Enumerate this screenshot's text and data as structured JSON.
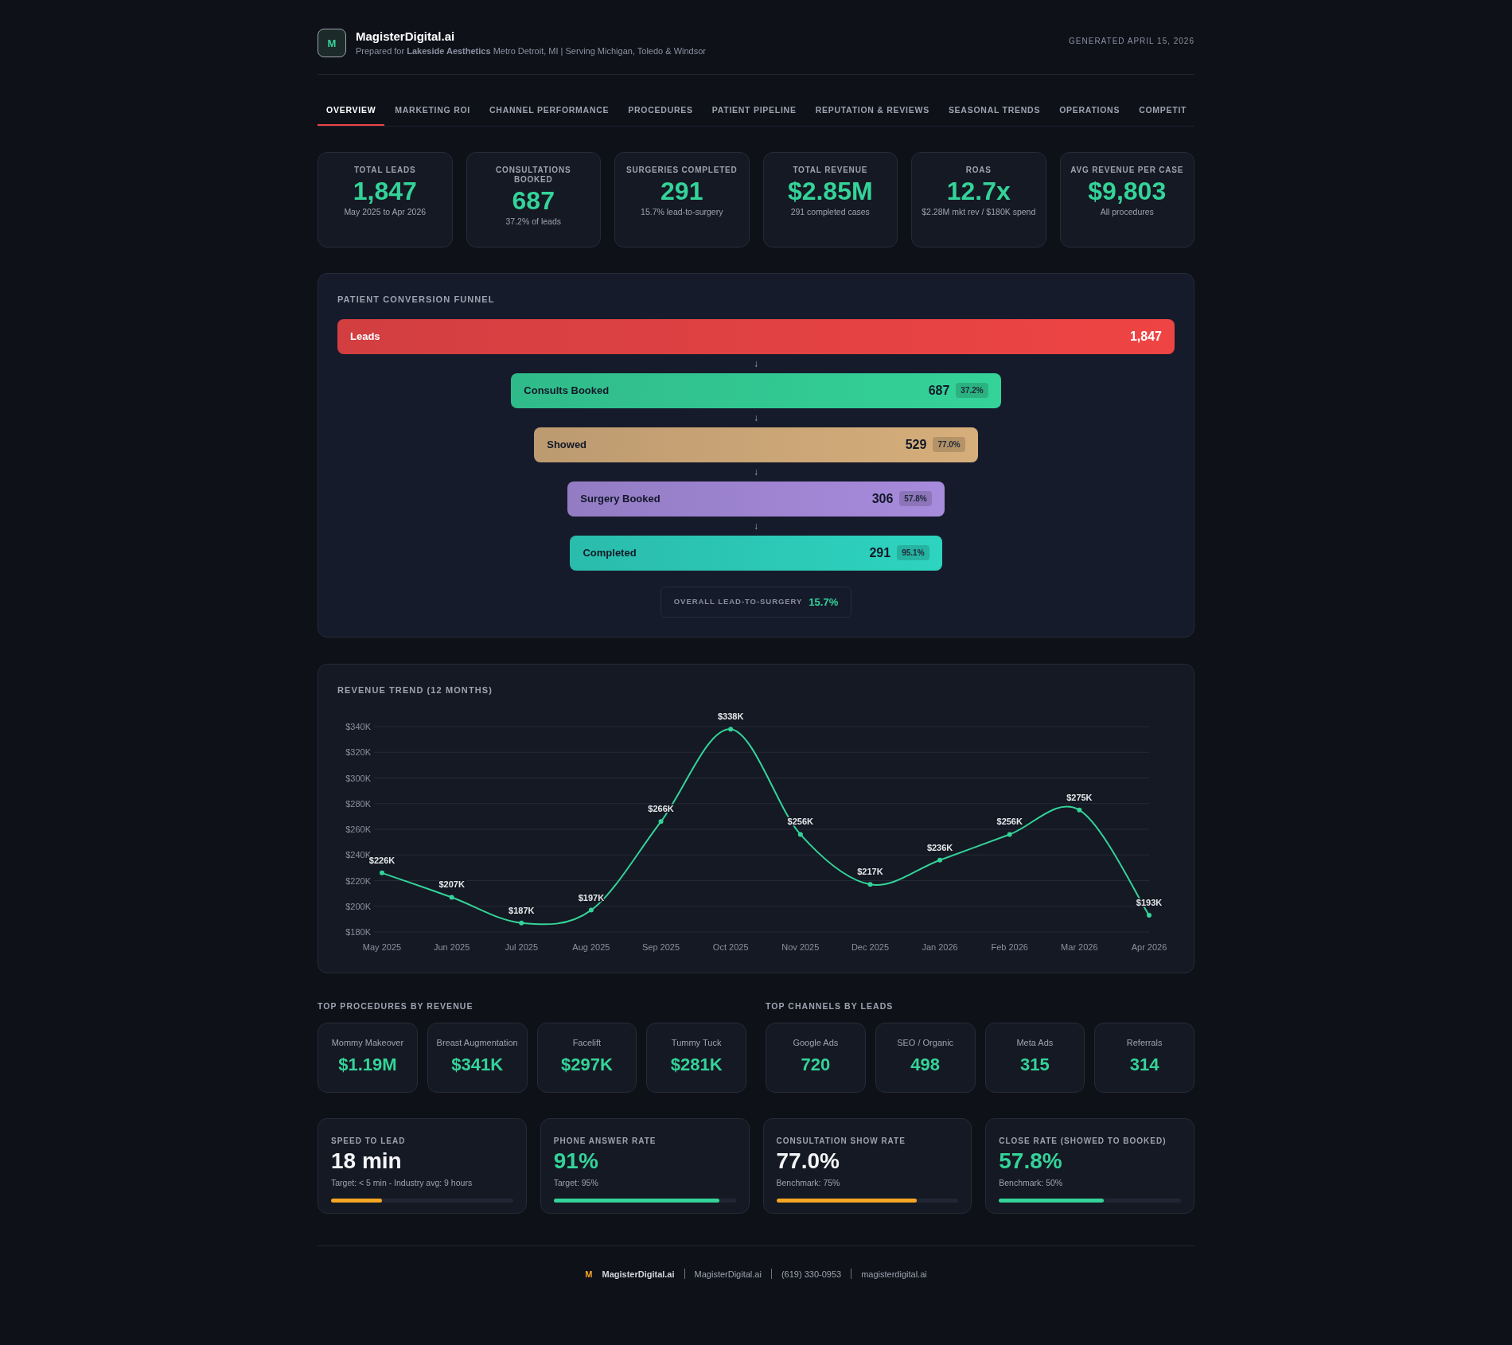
{
  "header": {
    "logo_letter": "M",
    "brand": "MagisterDigital.ai",
    "subtitle": "Prepared for **Lakeside Aesthetics** Metro Detroit, MI | Serving Michigan, Toledo & Windsor",
    "generated": "GENERATED APRIL 15, 2026"
  },
  "tabs": [
    {
      "label": "OVERVIEW",
      "selected": true
    },
    {
      "label": "MARKETING ROI",
      "selected": false
    },
    {
      "label": "CHANNEL PERFORMANCE",
      "selected": false
    },
    {
      "label": "PROCEDURES",
      "selected": false
    },
    {
      "label": "PATIENT PIPELINE",
      "selected": false
    },
    {
      "label": "REPUTATION & REVIEWS",
      "selected": false
    },
    {
      "label": "SEASONAL TRENDS",
      "selected": false
    },
    {
      "label": "OPERATIONS",
      "selected": false
    },
    {
      "label": "COMPETIT",
      "selected": false
    }
  ],
  "kpis": [
    {
      "label": "TOTAL LEADS",
      "value": "1,847",
      "note": "May 2025 to Apr 2026"
    },
    {
      "label": "CONSULTATIONS BOOKED",
      "value": "687",
      "note": "37.2% of leads"
    },
    {
      "label": "SURGERIES COMPLETED",
      "value": "291",
      "note": "15.7% lead-to-surgery"
    },
    {
      "label": "TOTAL REVENUE",
      "value": "$2.85M",
      "note": "291 completed cases"
    },
    {
      "label": "ROAS",
      "value": "12.7x",
      "note": "$2.28M mkt rev / $180K spend"
    },
    {
      "label": "AVG REVENUE PER CASE",
      "value": "$9,803",
      "note": "All procedures"
    }
  ],
  "funnel": {
    "title": "PATIENT CONVERSION FUNNEL",
    "stages": [
      {
        "name": "Leads",
        "count": "1,847",
        "color": "#ef4444"
      },
      {
        "name": "Consults Booked",
        "count": "687",
        "rate": "37.2%",
        "color": "#34d399"
      },
      {
        "name": "Showed",
        "count": "529",
        "rate": "77.0%",
        "color": "#d6ae7b"
      },
      {
        "name": "Surgery Booked",
        "count": "306",
        "rate": "57.8%",
        "color": "#a78bdc"
      },
      {
        "name": "Completed",
        "count": "291",
        "rate": "95.1%",
        "color": "#2dd4bf"
      }
    ],
    "arrow": "↓",
    "overall_label": "OVERALL LEAD-TO-SURGERY",
    "overall_value": "15.7%"
  },
  "revenue_trend": {
    "title": "REVENUE TREND (12 MONTHS)",
    "chart_data": {
      "type": "line",
      "categories": [
        "May 2025",
        "Jun 2025",
        "Jul 2025",
        "Aug 2025",
        "Sep 2025",
        "Oct 2025",
        "Nov 2025",
        "Dec 2025",
        "Jan 2026",
        "Feb 2026",
        "Mar 2026",
        "Apr 2026"
      ],
      "grid": true,
      "series": [
        {
          "color": "#34d399",
          "marker": true,
          "values": [
            226,
            207,
            187,
            197,
            266,
            338,
            256,
            217,
            236,
            256,
            275,
            193
          ]
        }
      ],
      "ylim": [
        180,
        340
      ],
      "yticks": [
        {
          "value": 180,
          "label": "$180K"
        },
        {
          "value": 200,
          "label": "$200K"
        },
        {
          "value": 220,
          "label": "$220K"
        },
        {
          "value": 240,
          "label": "$240K"
        },
        {
          "value": 260,
          "label": "$260K"
        },
        {
          "value": 280,
          "label": "$280K"
        },
        {
          "value": 300,
          "label": "$300K"
        },
        {
          "value": 320,
          "label": "$320K"
        },
        {
          "value": 340,
          "label": "$340K"
        }
      ],
      "value_labels": [
        "$226K",
        "$207K",
        "$187K",
        "$197K",
        "$266K",
        "$338K",
        "$256K",
        "$217K",
        "$236K",
        "$256K",
        "$275K",
        "$193K"
      ]
    }
  },
  "top_procedures": {
    "title": "TOP PROCEDURES BY REVENUE",
    "items": [
      {
        "name": "Mommy Makeover",
        "value": "$1.19M"
      },
      {
        "name": "Breast Augmentation",
        "value": "$341K"
      },
      {
        "name": "Facelift",
        "value": "$297K"
      },
      {
        "name": "Tummy Tuck",
        "value": "$281K"
      }
    ]
  },
  "top_channels": {
    "title": "TOP CHANNELS BY LEADS",
    "items": [
      {
        "name": "Google Ads",
        "value": "720"
      },
      {
        "name": "SEO / Organic",
        "value": "498"
      },
      {
        "name": "Meta Ads",
        "value": "315"
      },
      {
        "name": "Referrals",
        "value": "314"
      }
    ]
  },
  "metrics": [
    {
      "label": "SPEED TO LEAD",
      "value": "18 min",
      "highlight": false,
      "note": "Target: < 5 min - Industry avg: 9 hours",
      "level": 0.28,
      "color": "#f5a623"
    },
    {
      "label": "PHONE ANSWER RATE",
      "value": "91%",
      "highlight": true,
      "note": "Target: 95%",
      "level": 0.91,
      "color": "#34d399"
    },
    {
      "label": "CONSULTATION SHOW RATE",
      "value": "77.0%",
      "highlight": false,
      "note": "Benchmark: 75%",
      "level": 0.77,
      "color": "#f5a623"
    },
    {
      "label": "CLOSE RATE (SHOWED TO BOOKED)",
      "value": "57.8%",
      "highlight": true,
      "note": "Benchmark: 50%",
      "level": 0.578,
      "color": "#34d399"
    }
  ],
  "footer": {
    "logo_letter": "M",
    "brand": "MagisterDigital.ai",
    "items": [
      "MagisterDigital.ai",
      "(619) 330-0953",
      "magisterdigital.ai"
    ]
  }
}
